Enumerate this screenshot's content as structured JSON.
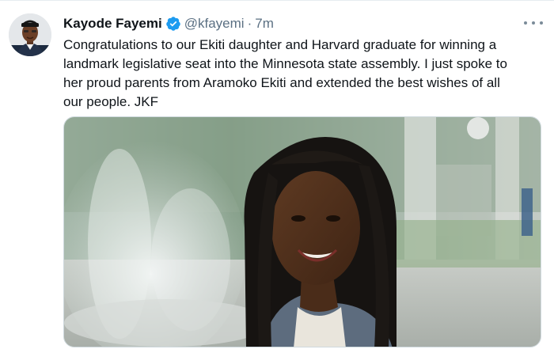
{
  "tweet": {
    "author_name": "Kayode Fayemi",
    "handle": "@kfayemi",
    "separator": "·",
    "time": "7m",
    "text_lines": [
      "Congratulations to our Ekiti daughter and Harvard graduate for winning a",
      "landmark legislative seat into the Minnesota state assembly. I just spoke to",
      "her proud parents from Aramoko Ekiti and extended the best wishes of all",
      "our people. JKF"
    ],
    "verified": true,
    "icons": {
      "verified": "verified-badge-icon",
      "more": "more-options-icon"
    }
  },
  "colors": {
    "text": "#0f1419",
    "secondary": "#5b7083",
    "verified_blue": "#1d9bf0",
    "border": "#cfd9de"
  }
}
